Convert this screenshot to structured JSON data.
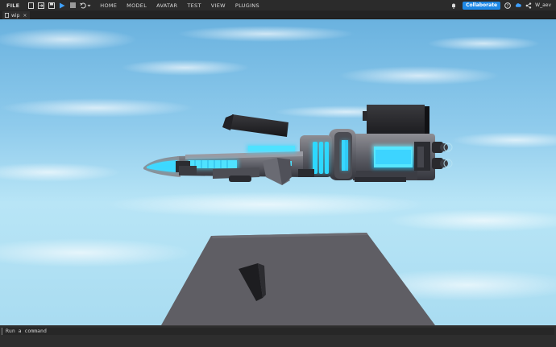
{
  "toolbar": {
    "file_label": "FILE",
    "menus": [
      "HOME",
      "MODEL",
      "AVATAR",
      "TEST",
      "VIEW",
      "PLUGINS"
    ],
    "collaborate_label": "Collaborate",
    "username": "W_aev"
  },
  "tabs": [
    {
      "label": "wip",
      "close": "×"
    }
  ],
  "command_bar": {
    "placeholder": "Run a command"
  },
  "colors": {
    "accent": "#1e88e5",
    "neon": "#2fd8ff",
    "sky_top": "#6fb5e0",
    "sky_bottom": "#b9e6f5"
  },
  "icons": [
    "new-file-icon",
    "import-icon",
    "save-icon",
    "play-icon",
    "stop-icon",
    "undo-icon",
    "redo-icon",
    "help-icon",
    "notification-icon",
    "collaborate-cloud-icon",
    "share-icon"
  ]
}
